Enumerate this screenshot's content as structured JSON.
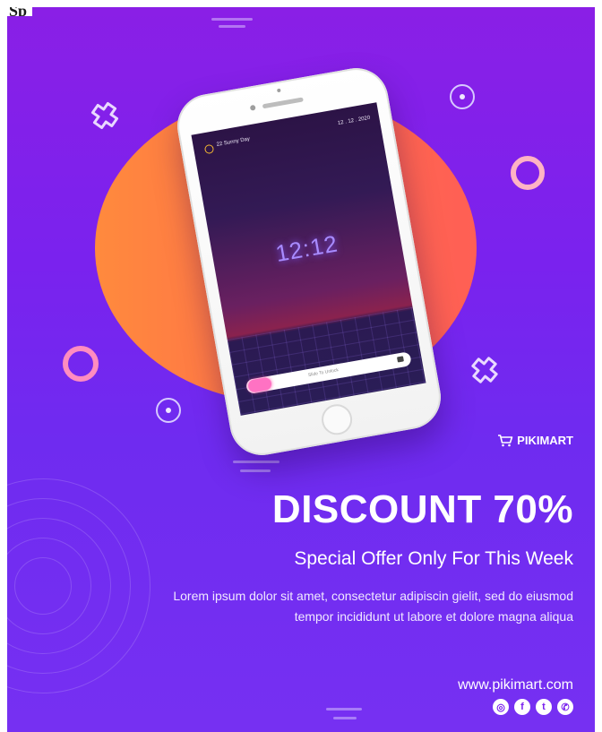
{
  "header": {
    "partial_text": "Sp"
  },
  "phone_screen": {
    "weather": "22  Sunny Day",
    "date": "12 . 12 . 2020",
    "clock": "12:12",
    "slide_text": "Slide To Unlock"
  },
  "brand": {
    "name": "PIKIMART",
    "icon": "cart-icon"
  },
  "promo": {
    "headline": "DISCOUNT 70%",
    "subhead": "Special Offer Only For This Week",
    "body": "Lorem ipsum dolor sit amet, consectetur adipiscin gielit, sed do eiusmod tempor incididunt ut labore et dolore magna aliqua"
  },
  "footer": {
    "url": "www.pikimart.com",
    "socials": [
      {
        "name": "instagram-icon",
        "glyph": "◎"
      },
      {
        "name": "facebook-icon",
        "glyph": "f"
      },
      {
        "name": "twitter-icon",
        "glyph": "t"
      },
      {
        "name": "whatsapp-icon",
        "glyph": "✆"
      }
    ]
  },
  "colors": {
    "background_top": "#8a1fe6",
    "background_bottom": "#7630f2",
    "circle_orange": "#ff6a4c",
    "accent_pink": "#ff72c3"
  }
}
